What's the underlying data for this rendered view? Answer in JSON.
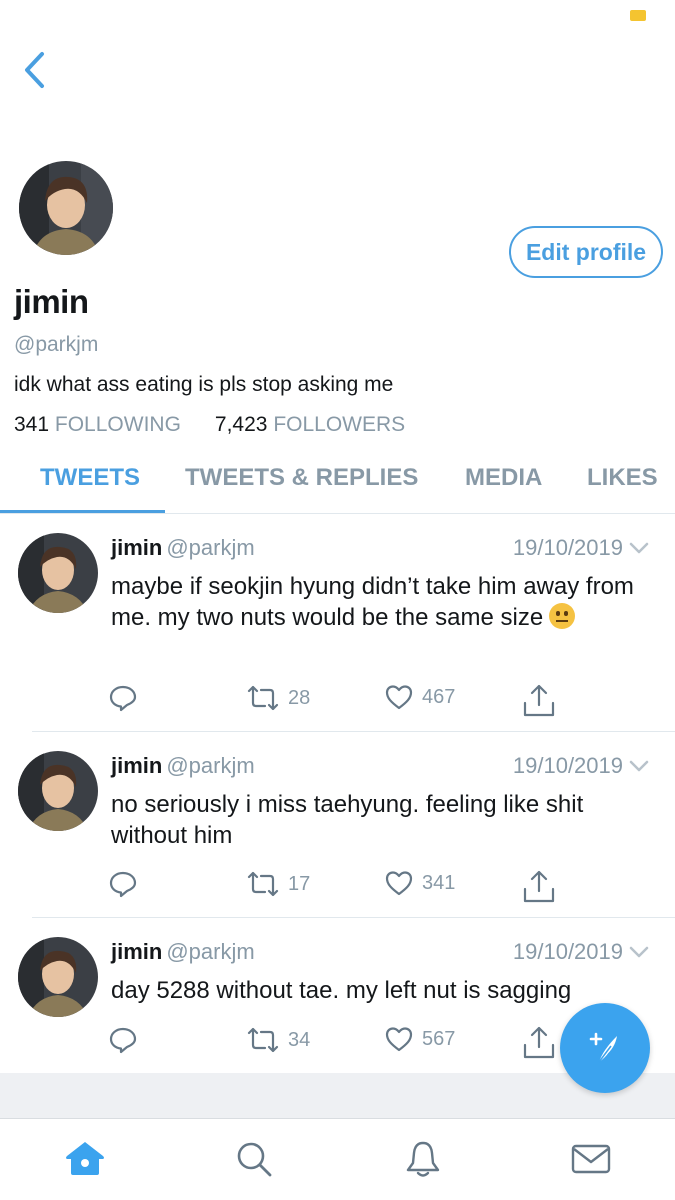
{
  "colors": {
    "accent": "#4a9fe0",
    "secondary_text": "#8899a6",
    "fab": "#3ba3ee",
    "battery": "#f4c430"
  },
  "nav": {
    "back_icon": "chevron-left-icon"
  },
  "profile": {
    "edit_label": "Edit profile",
    "name": "jimin",
    "handle": "@parkjm",
    "bio": "idk what ass eating is pls stop asking me",
    "following_count": "341",
    "following_label": "FOLLOWING",
    "followers_count": "7,423",
    "followers_label": "FOLLOWERS"
  },
  "tabs": [
    {
      "label": "TWEETS",
      "active": true
    },
    {
      "label": "TWEETS & REPLIES",
      "active": false
    },
    {
      "label": "MEDIA",
      "active": false
    },
    {
      "label": "LIKES",
      "active": false
    }
  ],
  "tweets": [
    {
      "name": "jimin",
      "handle": "@parkjm",
      "date": "19/10/2019",
      "text": "maybe if seokjin hyung didn’t take him away from me. my two nuts would be the same size",
      "emoji": "neutral-face",
      "retweets": "28",
      "likes": "467"
    },
    {
      "name": "jimin",
      "handle": "@parkjm",
      "date": "19/10/2019",
      "text": "no seriously i miss taehyung. feeling like shit without him",
      "retweets": "17",
      "likes": "341"
    },
    {
      "name": "jimin",
      "handle": "@parkjm",
      "date": "19/10/2019",
      "text": "day 5288 without tae. my left nut is sagging",
      "retweets": "34",
      "likes": "567"
    }
  ],
  "tabbar": [
    "home-icon",
    "search-icon",
    "notifications-icon",
    "messages-icon"
  ],
  "fab_icon": "compose-tweet-icon"
}
